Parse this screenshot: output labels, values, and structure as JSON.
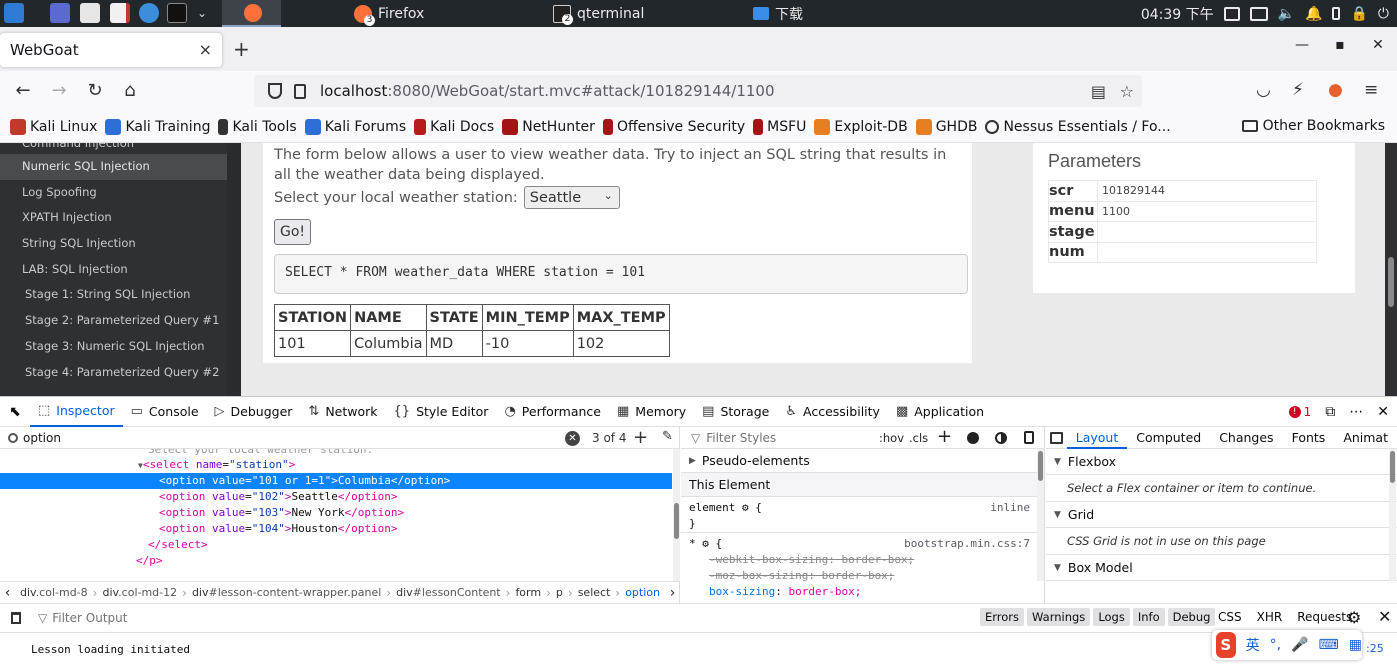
{
  "taskbar": {
    "tasks": [
      {
        "label": "Firefox",
        "badge": "3"
      },
      {
        "label": "qterminal",
        "badge": "2"
      },
      {
        "label": "下载",
        "badge": ""
      }
    ],
    "clock": "04:39 下午"
  },
  "browser": {
    "tab_title": "WebGoat",
    "tab_close": "×",
    "new_tab": "+",
    "url_host": "localhost",
    "url_rest": ":8080/WebGoat/start.mvc#attack/101829144/1100",
    "bookmarks": [
      "Kali Linux",
      "Kali Training",
      "Kali Tools",
      "Kali Forums",
      "Kali Docs",
      "NetHunter",
      "Offensive Security",
      "MSFU",
      "Exploit-DB",
      "GHDB",
      "Nessus Essentials / Fo..."
    ],
    "other_bookmarks": "Other Bookmarks"
  },
  "colors": {
    "accent": "#0060df",
    "selection": "#0a84ff",
    "menu_bg": "#2f3033"
  },
  "sidebar": {
    "items": [
      {
        "label": "Command Injection",
        "sub": false,
        "selected": false,
        "clipped": true
      },
      {
        "label": "Numeric SQL Injection",
        "sub": false,
        "selected": true,
        "clipped": false
      },
      {
        "label": "Log Spoofing",
        "sub": false,
        "selected": false,
        "clipped": false
      },
      {
        "label": "XPATH Injection",
        "sub": false,
        "selected": false,
        "clipped": false
      },
      {
        "label": "String SQL Injection",
        "sub": false,
        "selected": false,
        "clipped": false
      },
      {
        "label": "LAB: SQL Injection",
        "sub": false,
        "selected": false,
        "clipped": false
      },
      {
        "label": "Stage 1: String SQL Injection",
        "sub": true,
        "selected": false,
        "clipped": false
      },
      {
        "label": "Stage 2: Parameterized Query #1",
        "sub": true,
        "selected": false,
        "clipped": false
      },
      {
        "label": "Stage 3: Numeric SQL Injection",
        "sub": true,
        "selected": false,
        "clipped": false
      },
      {
        "label": "Stage 4: Parameterized Query #2",
        "sub": true,
        "selected": false,
        "clipped": false
      }
    ]
  },
  "lesson": {
    "intro": "The form below allows a user to view weather data. Try to inject an SQL string that results in all the weather data being displayed.",
    "station_label": "Select your local weather station:",
    "station_selected": "Seattle",
    "go_label": "Go!",
    "sql": "SELECT * FROM weather_data WHERE station = 101",
    "table": {
      "headers": [
        "STATION",
        "NAME",
        "STATE",
        "MIN_TEMP",
        "MAX_TEMP"
      ],
      "rows": [
        [
          "101",
          "Columbia",
          "MD",
          "-10",
          "102"
        ]
      ]
    }
  },
  "params": {
    "title": "Parameters",
    "rows": [
      {
        "key": "scr",
        "value": "101829144"
      },
      {
        "key": "menu",
        "value": "1100"
      },
      {
        "key": "stage",
        "value": ""
      },
      {
        "key": "num",
        "value": ""
      }
    ]
  },
  "devtools": {
    "tabs": [
      {
        "label": "Inspector",
        "glyph": "⬚",
        "active": true
      },
      {
        "label": "Console",
        "glyph": "▭",
        "active": false
      },
      {
        "label": "Debugger",
        "glyph": "▷",
        "active": false
      },
      {
        "label": "Network",
        "glyph": "⇅",
        "active": false
      },
      {
        "label": "Style Editor",
        "glyph": "{}",
        "active": false
      },
      {
        "label": "Performance",
        "glyph": "◔",
        "active": false
      },
      {
        "label": "Memory",
        "glyph": "▦",
        "active": false
      },
      {
        "label": "Storage",
        "glyph": "▤",
        "active": false
      },
      {
        "label": "Accessibility",
        "glyph": "♿",
        "active": false
      },
      {
        "label": "Application",
        "glyph": "▩",
        "active": false
      }
    ],
    "error_count": "1",
    "search_value": "option",
    "search_count": "3 of 4",
    "markup": {
      "clipped_text": "Select your local weather station:",
      "select_tag": "select",
      "select_attr_name": "name",
      "select_attr_value": "station",
      "options": [
        {
          "value": "101 or 1=1",
          "text": "Columbia",
          "selected": true
        },
        {
          "value": "102",
          "text": "Seattle",
          "selected": false
        },
        {
          "value": "103",
          "text": "New York",
          "selected": false
        },
        {
          "value": "104",
          "text": "Houston",
          "selected": false
        }
      ],
      "close_select": "</select>",
      "close_p": "</p>"
    },
    "breadcrumbs": [
      {
        "tag": "div",
        "cls": ".col-md-8",
        "current": false
      },
      {
        "tag": "div",
        "cls": ".col-md-12",
        "current": false
      },
      {
        "tag": "div",
        "cls": "#lesson-content-wrapper.panel",
        "current": false
      },
      {
        "tag": "div",
        "cls": "#lessonContent",
        "current": false
      },
      {
        "tag": "form",
        "cls": "",
        "current": false
      },
      {
        "tag": "p",
        "cls": "",
        "current": false
      },
      {
        "tag": "select",
        "cls": "",
        "current": false
      },
      {
        "tag": "option",
        "cls": "",
        "current": true
      }
    ],
    "rules": {
      "filter_placeholder": "Filter Styles",
      "hov": ":hov",
      "cls": ".cls",
      "pseudo": "Pseudo-elements",
      "this_element": "This Element",
      "element_selector": "element",
      "element_source": "inline",
      "star_selector": "*",
      "star_source": "bootstrap.min.css:7",
      "decl1": "-webkit-box-sizing: border-box;",
      "decl2": "-moz-box-sizing: border-box;",
      "decl3_name": "box-sizing",
      "decl3_value": "border-box;"
    },
    "layout": {
      "tabs": [
        "Layout",
        "Computed",
        "Changes",
        "Fonts",
        "Animat"
      ],
      "flexbox": "Flexbox",
      "flexbox_note": "Select a Flex container or item to continue.",
      "grid": "Grid",
      "grid_note": "CSS Grid is not in use on this page",
      "box_model": "Box Model"
    },
    "console": {
      "filter_placeholder": "Filter Output",
      "levels": [
        "Errors",
        "Warnings",
        "Logs",
        "Info",
        "Debug"
      ],
      "net": [
        "CSS",
        "XHR",
        "Requests"
      ],
      "message": "Lesson loading initiated"
    },
    "ime": {
      "logo": "S",
      "lang": "英",
      "time": ":25"
    }
  }
}
